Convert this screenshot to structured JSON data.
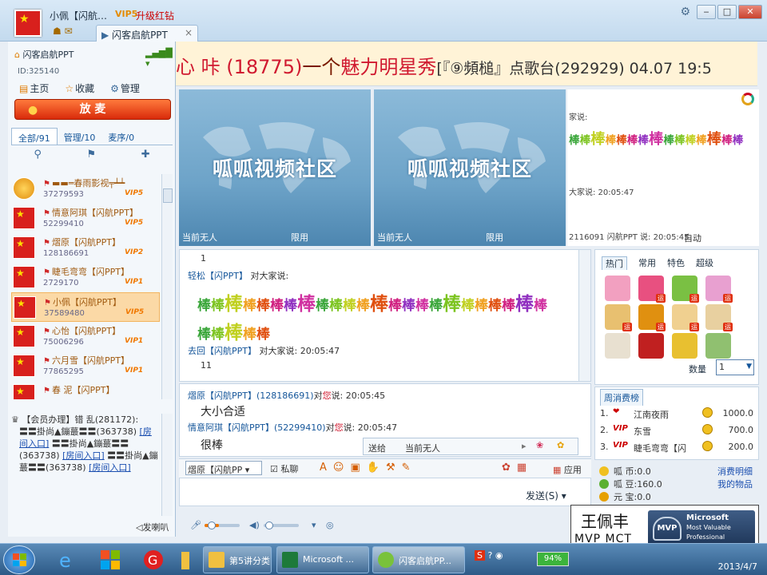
{
  "title_bar": {
    "user": "小佩【闪航…",
    "vip": "VIP5",
    "upgrade": "升级红钻",
    "tab": "闪客启航PPT",
    "tab_close": "×"
  },
  "left": {
    "room_name": "闪客启航PPT",
    "room_id": "ID:325140",
    "nav": {
      "home": "主页",
      "fav": "收藏",
      "manage": "管理"
    },
    "mic_button": "放 麦",
    "tabs": [
      "全部/91",
      "管理/10",
      "麦序/0"
    ],
    "users": [
      {
        "name": "▬▬═春雨影视╤┷┷",
        "id": "37279593",
        "vip": "VIP5",
        "flag": "sun"
      },
      {
        "name": "情意阿琪【闪航PPT】",
        "id": "52299410",
        "vip": "VIP5",
        "flag": "cn"
      },
      {
        "name": "熠原【闪航PPT】",
        "id": "128186691",
        "vip": "VIP2",
        "flag": "cn"
      },
      {
        "name": "睫毛弯弯【闪PPT】",
        "id": "2729170",
        "vip": "VIP1",
        "flag": "cn"
      },
      {
        "name": "小佩【闪航PPT】",
        "id": "37589480",
        "vip": "VIP5",
        "flag": "cn",
        "selected": true
      },
      {
        "name": "心怡【闪航PPT】",
        "id": "75006296",
        "vip": "VIP1",
        "flag": "cn"
      },
      {
        "name": "六月雪【闪航PPT】",
        "id": "77865295",
        "vip": "VIP1",
        "flag": "cn"
      },
      {
        "name": "春 泥【闪PPT】",
        "id": "",
        "vip": "",
        "flag": "red"
      }
    ],
    "message": {
      "title": "【会员办理】错 乱(281172):",
      "line1": "〓〓掛尚▲鏰蕞〓〓(363738)",
      "link1": "[房间入口]",
      "line2": "〓〓掛尚▲鏰蕞〓〓(363738)",
      "link2": "[房间入口]",
      "line3": "〓〓掛尚▲鏰蕞〓〓(363738)",
      "link3": "[房间入口]"
    },
    "horn": "发喇叭"
  },
  "banner": {
    "part1": "心 咔 (18775)",
    "part2": "一个",
    "part3": "魅力明星秀",
    "part4": "[『⑨頻槌』点歌台(292929) 04.07 19:5"
  },
  "videos": [
    {
      "logo": "呱呱视频社区",
      "left": "当前无人",
      "right": "限用"
    },
    {
      "logo": "呱呱视频社区",
      "left": "当前无人",
      "right": "限用"
    }
  ],
  "public_chat": {
    "line1": "家说:",
    "rain": "棒棒棒棒棒棒棒棒棒棒棒棒棒棒棒",
    "line2": "大家说: 20:05:47",
    "line3": "2116091 闪航PPT 说: 20:05:45",
    "auto": "自动"
  },
  "chat": {
    "n1": "1",
    "line1_name": "轻松【闪PPT】",
    "line1_text": "对大家说:",
    "rain1": "棒棒棒棒棒棒棒棒棒棒棒棒棒棒棒棒棒棒棒棒棒棒棒棒",
    "rain2": "棒棒棒棒棒",
    "line2_name": "去回【闪航PPT】",
    "line2_text": "对大家说: 20:05:47",
    "n2": "11"
  },
  "private_chat": {
    "l1_name": "熠原【闪航PPT】(128186691)",
    "l1_to": "对",
    "l1_you": "您",
    "l1_rest": "说: 20:05:45",
    "m1": "大小合适",
    "l2_name": "情意阿琪【闪航PPT】(52299410)",
    "l2_to": "对",
    "l2_you": "您",
    "l2_rest": "说: 20:05:47",
    "m2": "很棒"
  },
  "send_to": {
    "label": "送给",
    "target": "当前无人"
  },
  "input_bar": {
    "user": "熠原【闪航PP",
    "private": "私聊",
    "app": "应用"
  },
  "send_button": "发送(S)",
  "gifts": {
    "tabs": [
      "热门",
      "常用",
      "特色",
      "超级"
    ],
    "yun_tag": "运",
    "qty_label": "数量",
    "qty": "1"
  },
  "ranking": {
    "tab": "周消费榜",
    "rows": [
      {
        "no": "1.",
        "icon": "❤",
        "name": "江南夜雨",
        "amount": "1000.0"
      },
      {
        "no": "2.",
        "icon": "VIP",
        "name": "东雪",
        "amount": "700.0"
      },
      {
        "no": "3.",
        "icon": "VIP",
        "name": "睫毛弯弯【闪",
        "amount": "200.0"
      }
    ]
  },
  "wallet": {
    "coin": "呱  币:0.0",
    "bean": "呱  豆:160.0",
    "treasure": "元  宝:0.0",
    "link1": "消费明细",
    "link2": "我的物品"
  },
  "mvp": {
    "name": "王佩丰",
    "role": "MVP  MCT",
    "mark": "MVP",
    "org": "Microsoft",
    "title1": "Most Valuable",
    "title2": "Professional"
  },
  "taskbar": {
    "btn1": "第5讲分类...",
    "btn2": "Microsoft ...",
    "btn3": "闪客启航PP...",
    "battery": "94%",
    "clock": "2013/4/7"
  },
  "colors": {
    "accent_orange": "#f07800",
    "banner_red": "#d01a30",
    "taskbar": "#2d5a87"
  }
}
